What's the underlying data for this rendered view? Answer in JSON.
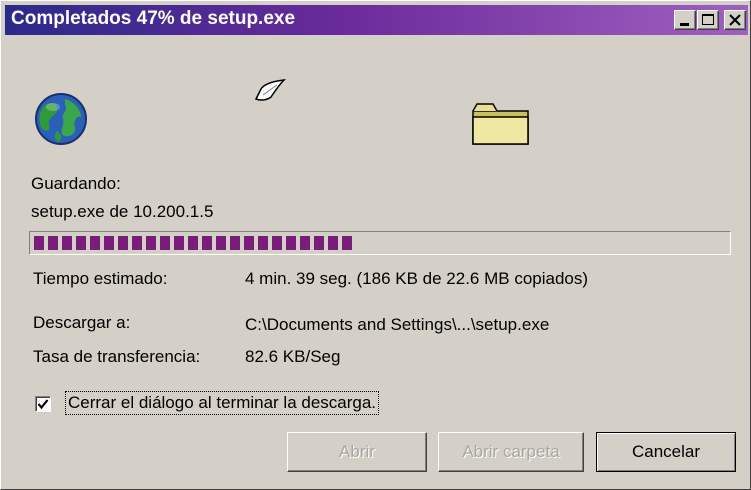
{
  "window": {
    "title": "Completados 47% de setup.exe",
    "title_bar_colors": [
      "#2a2a8a",
      "#a060c0"
    ]
  },
  "title_buttons": [
    "minimize-icon",
    "maximize-icon",
    "close-icon"
  ],
  "icons": [
    "globe-icon",
    "paper-icon",
    "folder-icon"
  ],
  "status": {
    "saving_label": "Guardando:",
    "source": "setup.exe de 10.200.1.5"
  },
  "progress": {
    "percent": 47,
    "fill_color": "#7a1c7a"
  },
  "details": {
    "time_label": "Tiempo estimado:",
    "time_value": "4 min. 39 seg. (186 KB de 22.6 MB copiados)",
    "dest_label": "Descargar a:",
    "dest_value": "C:\\Documents and Settings\\...\\setup.exe",
    "rate_label": "Tasa de transferencia:",
    "rate_value": "82.6 KB/Seg"
  },
  "close_option": {
    "checked": true,
    "label": "Cerrar el diálogo al terminar la descarga."
  },
  "buttons": {
    "open": "Abrir",
    "open_folder": "Abrir carpeta",
    "cancel": "Cancelar"
  }
}
